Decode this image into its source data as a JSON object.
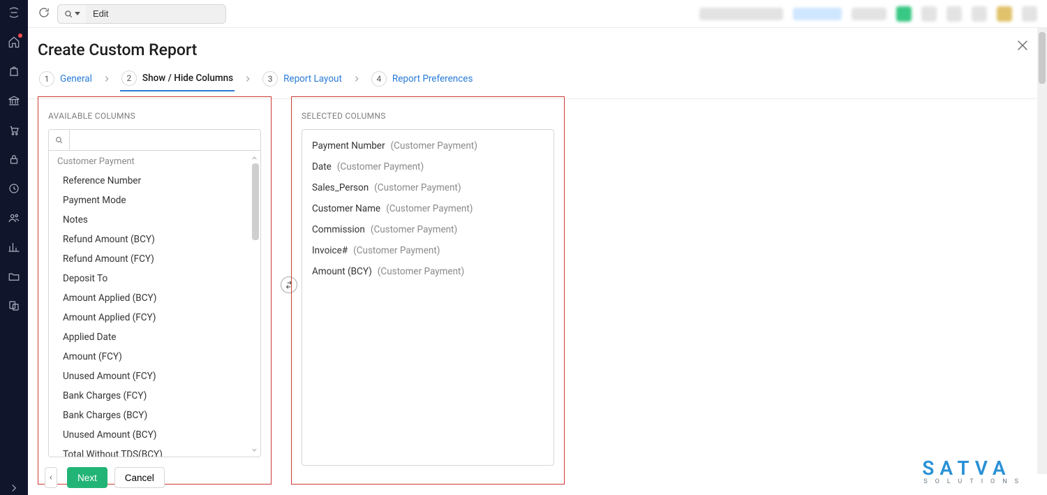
{
  "topbar": {
    "search_value": "Edit"
  },
  "sidebar": {
    "items": [
      {
        "name": "logo",
        "interactable": true
      },
      {
        "name": "home",
        "interactable": true,
        "badge": true
      },
      {
        "name": "bag",
        "interactable": true
      },
      {
        "name": "bank",
        "interactable": true
      },
      {
        "name": "cart",
        "interactable": true
      },
      {
        "name": "lock",
        "interactable": true
      },
      {
        "name": "clock",
        "interactable": true
      },
      {
        "name": "people",
        "interactable": true
      },
      {
        "name": "chart",
        "interactable": true
      },
      {
        "name": "folder",
        "interactable": true
      },
      {
        "name": "docshare",
        "interactable": true
      }
    ],
    "expander": "›"
  },
  "page_title": "Create Custom Report",
  "wizard": [
    {
      "num": "1",
      "label": "General",
      "active": false
    },
    {
      "num": "2",
      "label": "Show / Hide Columns",
      "active": true
    },
    {
      "num": "3",
      "label": "Report Layout",
      "active": false
    },
    {
      "num": "4",
      "label": "Report Preferences",
      "active": false
    }
  ],
  "available_columns": {
    "title": "AVAILABLE COLUMNS",
    "search_value": "",
    "group_header": "Customer Payment",
    "items": [
      "Reference Number",
      "Payment Mode",
      "Notes",
      "Refund Amount (BCY)",
      "Refund Amount (FCY)",
      "Deposit To",
      "Amount Applied (BCY)",
      "Amount Applied (FCY)",
      "Applied Date",
      "Amount (FCY)",
      "Unused Amount (FCY)",
      "Bank Charges (FCY)",
      "Bank Charges (BCY)",
      "Unused Amount (BCY)",
      "Total Without TDS(BCY)"
    ]
  },
  "selected_columns": {
    "title": "SELECTED COLUMNS",
    "items": [
      {
        "name": "Payment Number",
        "source": "(Customer Payment)"
      },
      {
        "name": "Date",
        "source": "(Customer Payment)"
      },
      {
        "name": "Sales_Person",
        "source": "(Customer Payment)"
      },
      {
        "name": "Customer Name",
        "source": "(Customer Payment)"
      },
      {
        "name": "Commission",
        "source": "(Customer Payment)"
      },
      {
        "name": "Invoice#",
        "source": "(Customer Payment)"
      },
      {
        "name": "Amount (BCY)",
        "source": "(Customer Payment)"
      }
    ]
  },
  "footer": {
    "next": "Next",
    "cancel": "Cancel"
  },
  "watermark": {
    "brand": "SATVA",
    "tag": "SOLUTIONS"
  }
}
